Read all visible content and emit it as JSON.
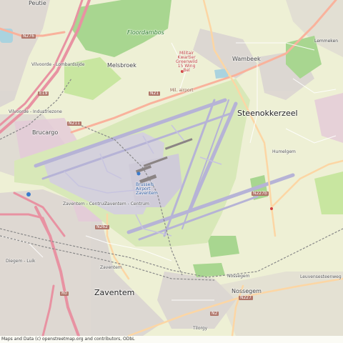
{
  "map": {
    "towns": [
      {
        "id": "zaventem",
        "text": "Zaventem"
      },
      {
        "id": "steenokkerzeel",
        "text": "Steenokkerzeel"
      }
    ],
    "villages": [
      {
        "id": "melsbroek",
        "text": "Melsbroek"
      },
      {
        "id": "brucargo",
        "text": "Brucargo"
      },
      {
        "id": "wambeek",
        "text": "Wambeek"
      },
      {
        "id": "nossegem",
        "text": "Nossegem"
      },
      {
        "id": "peutie",
        "text": "Peutie"
      },
      {
        "id": "humelgem",
        "text": "Humelgem"
      },
      {
        "id": "lemmeken",
        "text": "Lemmeken"
      }
    ],
    "areas": [
      {
        "id": "floordambos",
        "text": "Floordambos"
      }
    ],
    "airport": {
      "name_lines": [
        "Brussels",
        "Airport",
        "Zaventem"
      ],
      "military": "Mil. airport",
      "military_barracks": [
        "Militair",
        "Kwartier",
        "Greenwild",
        "15 Wing",
        "Bel"
      ]
    },
    "roads": [
      {
        "id": "n276",
        "text": "N276"
      },
      {
        "id": "e19",
        "text": "E19"
      },
      {
        "id": "n211",
        "text": "N211"
      },
      {
        "id": "n21",
        "text": "N21"
      },
      {
        "id": "n227b",
        "text": "N227b"
      },
      {
        "id": "n262",
        "text": "N262"
      },
      {
        "id": "r0",
        "text": "R0"
      },
      {
        "id": "n2",
        "text": "N2"
      },
      {
        "id": "n227",
        "text": "N227"
      },
      {
        "id": "e40",
        "text": "E40"
      }
    ],
    "stations": [
      {
        "id": "vilvoorde",
        "text": "Vilvoorde - Lombardsijde"
      },
      {
        "id": "vilvoorde_ind",
        "text": "Vilvoorde - Industriezone"
      },
      {
        "id": "zaventem_centrum",
        "text": "Zaventem - Centrum"
      },
      {
        "id": "diegem",
        "text": "Diegem - Luik"
      },
      {
        "id": "nossegem_st",
        "text": "Nossegem"
      },
      {
        "id": "zaventem_st",
        "text": "Zaventem"
      }
    ],
    "streets": [
      {
        "id": "haachtsesteenweg",
        "text": "Haachtsesteenweg"
      },
      {
        "id": "woluwelaan",
        "text": "Woluwelaan"
      },
      {
        "id": "leuvensesteenweg",
        "text": "Leuvensesteenweg"
      },
      {
        "id": "tervuursesteenweg",
        "text": "Tervuursesteenweg"
      },
      {
        "id": "kortenbergsesteenweg",
        "text": "Kortenbergsesteenweg"
      },
      {
        "id": "tilorgy",
        "text": "Tilorgy"
      }
    ],
    "colors": {
      "background": "#eef0d5",
      "urban": "#dcd6d2",
      "airport_apron": "#d4d1dc",
      "runway": "#b6b3d6",
      "grass": "#c8e6a0",
      "forest": "#a8d690",
      "water": "#aad3df",
      "motorway": "#e892a2",
      "trunk": "#f9b29c",
      "primary": "#fcd6a4",
      "rail": "#888888"
    }
  },
  "attribution": "Maps and Data (c) openstreetmap.org and contributors, ODbL"
}
